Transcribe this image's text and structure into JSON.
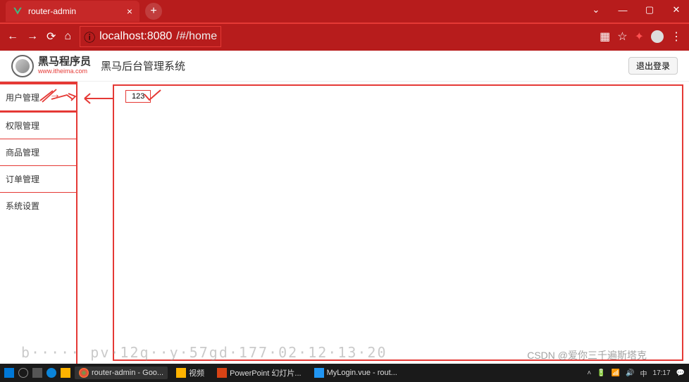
{
  "browser": {
    "tab_title": "router-admin",
    "url_host": "localhost:8080",
    "url_path": "/#/home"
  },
  "header": {
    "logo_ch": "黑马程序员",
    "logo_en": "www.itheima.com",
    "title": "黑马后台管理系统",
    "logout": "退出登录"
  },
  "sidebar": {
    "items": [
      "用户管理",
      "权限管理",
      "商品管理",
      "订单管理",
      "系统设置"
    ]
  },
  "main": {
    "box_text": "123"
  },
  "taskbar": {
    "items": [
      {
        "label": "router-admin - Goo...",
        "color": "#4caf50"
      },
      {
        "label": "视频",
        "color": "#ffb300"
      },
      {
        "label": "PowerPoint 幻灯片...",
        "color": "#d84315"
      },
      {
        "label": "MyLogin.vue - rout...",
        "color": "#2196f3"
      }
    ],
    "time": "17:17"
  },
  "watermark": "CSDN @爱你三千遍斯塔克",
  "faded": "b····· pv·12q··y·57gd·177·02·12·13·20"
}
